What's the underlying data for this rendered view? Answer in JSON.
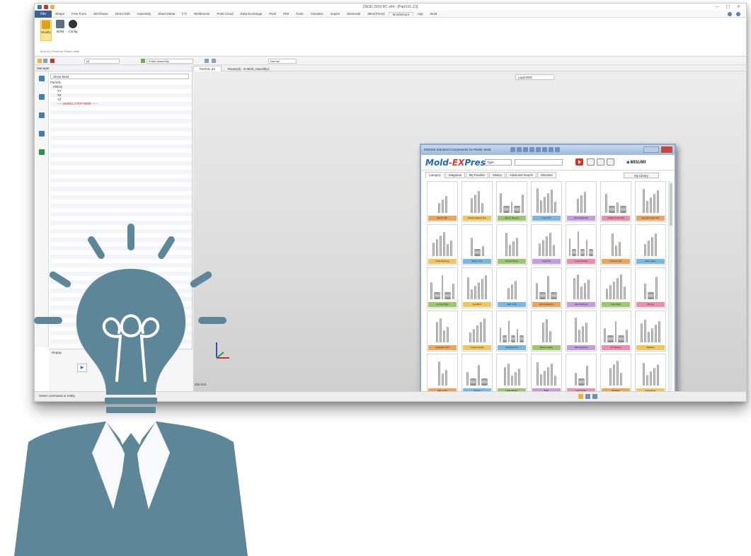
{
  "app": {
    "window_title": "ZW3D 2016 RC x64 - [PartXXL.Z3]",
    "file_tab": "File",
    "menu": [
      "Shape",
      "Free Form",
      "Wireframe",
      "Direct Edit",
      "Assembly",
      "Sheet Metal",
      "FTI",
      "Weldments",
      "Point Cloud",
      "Data Exchange",
      "Pixel",
      "PMI",
      "Tools",
      "Visualize",
      "Inquire",
      "Electrode",
      "MEX(Press)",
      "MoldWizard",
      "App",
      "Mold"
    ],
    "active_menu_index": 17
  },
  "ribbon": {
    "buttons": [
      "Modify",
      "BOM",
      "Config"
    ],
    "group_label": "Mold EX-Press for Plastic Mold"
  },
  "cmdbar": {
    "filter_value": "All",
    "scope_value": "Entire Assembly",
    "style_value": "Normal"
  },
  "manager": {
    "title": "Manager",
    "selector": "Show Most",
    "tree": [
      {
        "label": "PartXXL",
        "level": 0
      },
      {
        "label": "History",
        "level": 1
      },
      {
        "label": "XY",
        "level": 2
      },
      {
        "label": "XZ",
        "level": 2
      },
      {
        "label": "YZ",
        "level": 2
      }
    ],
    "stop_marker": "----- MODEL STOP HERE -----",
    "replay_label": "Replay"
  },
  "viewport": {
    "tabs": [
      "PartXXL.Z3",
      "Routes(Z) - 2t Mold_Assembly1"
    ],
    "layer": "Layer0000",
    "scale": "200 mm"
  },
  "statusbar": {
    "text": "Select command or entity"
  },
  "dialog": {
    "title": "MISUMI Standard Components for Plastic Mold",
    "logo_main": "Mold",
    "logo_ex": "-EX",
    "logo_press": "Press",
    "type_select": "Type",
    "brand": "MISUMI",
    "tabs": [
      "Category",
      "Diagrams",
      "My Favorite",
      "History",
      "Advanced Search",
      "Structure"
    ],
    "my_library": "My Library",
    "categories": [
      {
        "label": "Ejector Pins",
        "color": "#f0a35b"
      },
      {
        "label": "Stepped Ejector Pins",
        "color": "#f3c65c"
      },
      {
        "label": "Ejector Sleeves",
        "color": "#9bc86a"
      },
      {
        "label": "Core Pins",
        "color": "#79b8e3"
      },
      {
        "label": "Sprue Bushings",
        "color": "#c79be0"
      },
      {
        "label": "Straight Guide Pins",
        "color": "#ef8ea8"
      },
      {
        "label": "Stepped Guide Pins",
        "color": "#f0a35b"
      },
      {
        "label": "Guide Bushings",
        "color": "#f3c65c"
      },
      {
        "label": "Return Pins",
        "color": "#79b8e3"
      },
      {
        "label": "Support Pillars",
        "color": "#9bc86a"
      },
      {
        "label": "Stop Pins",
        "color": "#c79be0"
      },
      {
        "label": "Locating Rings",
        "color": "#ef8ea8"
      },
      {
        "label": "Parting Locks",
        "color": "#f0a35b"
      },
      {
        "label": "Plate Lifters",
        "color": "#79b8e3"
      },
      {
        "label": "Cooling Plugs",
        "color": "#9bc86a"
      },
      {
        "label": "Eye Bolts",
        "color": "#f3c65c"
      },
      {
        "label": "Slide Units",
        "color": "#79b8e3"
      },
      {
        "label": "Spring Retainers",
        "color": "#f0a35b"
      },
      {
        "label": "Gate Bushings",
        "color": "#c79be0"
      },
      {
        "label": "Date Marks",
        "color": "#9bc86a"
      },
      {
        "label": "Springs",
        "color": "#ef8ea8"
      },
      {
        "label": "Inspection Pins",
        "color": "#f0a35b"
      },
      {
        "label": "Cooling Fittings",
        "color": "#f3c65c"
      },
      {
        "label": "Coupling Parts",
        "color": "#79b8e3"
      },
      {
        "label": "Ejector Guides",
        "color": "#9bc86a"
      },
      {
        "label": "Slide Retainers",
        "color": "#c79be0"
      },
      {
        "label": "Air Poppets",
        "color": "#ef8ea8"
      },
      {
        "label": "Washers",
        "color": "#f3c65c"
      },
      {
        "label": "Side Locks",
        "color": "#f0a35b"
      },
      {
        "label": "Screws",
        "color": "#79b8e3"
      },
      {
        "label": "Heater Bands",
        "color": "#9bc86a"
      },
      {
        "label": "Bolts",
        "color": "#c79be0"
      },
      {
        "label": "Latch Locks",
        "color": "#ef8ea8"
      },
      {
        "label": "Plungers",
        "color": "#f0a35b"
      },
      {
        "label": "Accessories",
        "color": "#f3c65c"
      }
    ]
  }
}
